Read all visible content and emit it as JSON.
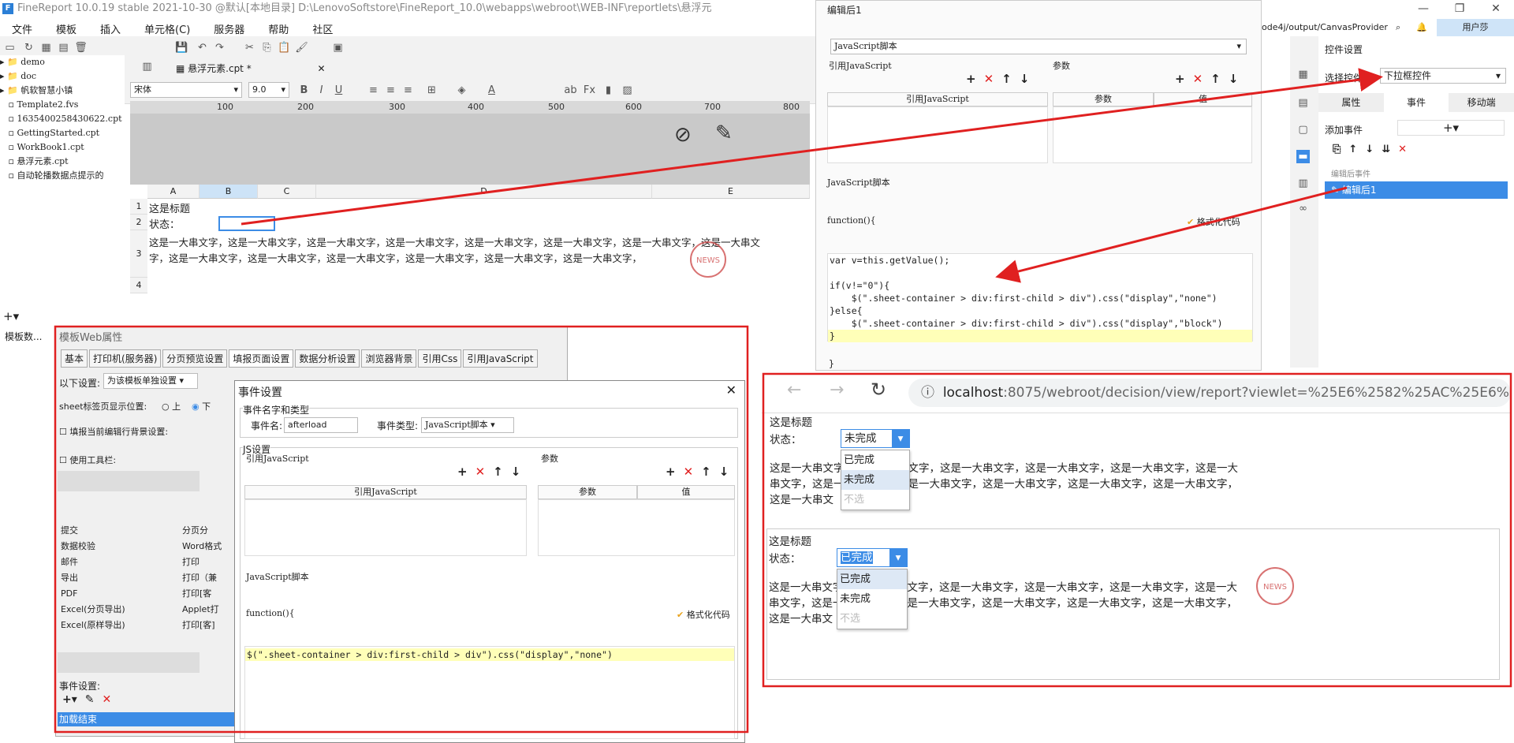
{
  "title": "FineReport 10.0.19 stable 2021-10-30 @默认[本地目录]   D:\\LenovoSoftstore\\FineReport_10.0\\webapps\\webroot\\WEB-INF\\reportlets\\悬浮元",
  "window_controls": [
    "—",
    "❐",
    "✕"
  ],
  "menu": [
    "文件",
    "模板",
    "插入",
    "单元格(C)",
    "服务器",
    "帮助",
    "社区"
  ],
  "file_tree": [
    "demo",
    "doc",
    "帆软智慧小镇",
    "Template2.fvs",
    "1635400258430622.cpt",
    "GettingStarted.cpt",
    "WorkBook1.cpt",
    "悬浮元素.cpt",
    "自动轮播数据点提示的"
  ],
  "left_bottom_label": "模板数...",
  "doc_tab": "悬浮元素.cpt *",
  "font_name": "宋体",
  "font_size": "9.0",
  "ruler": [
    "0",
    "100",
    "200",
    "300",
    "400",
    "500",
    "600",
    "700",
    "800"
  ],
  "ruler_right": "400",
  "columns": [
    "A",
    "B",
    "C",
    "D",
    "E"
  ],
  "rows": [
    "1",
    "2",
    "3",
    "4"
  ],
  "sheet": {
    "title_cell": "这是标题",
    "status_label": "状态：",
    "long_text": "这是一大串文字，这是一大串文字，这是一大串文字，这是一大串文字，这是一大串文字，这是一大串文字，这是一大串文字，这是一大串文字，这是一大串文字，这是一大串文字，这是一大串文字，这是一大串文字，这是一大串文字，这是一大串文字，"
  },
  "stamp_text": "NEWS",
  "js_dialog": {
    "title": "编辑后1",
    "type": "JavaScript脚本",
    "ref_js": "引用JavaScript",
    "params": "参数",
    "col_ref": "引用JavaScript",
    "col_param": "参数",
    "col_value": "值",
    "script_label": "JavaScript脚本",
    "fn_header": "function(){",
    "format_code": "格式化代码",
    "code": "var v=this.getValue();\n\nif(v!=\"0\"){\n    $(\".sheet-container > div:first-child > div\").css(\"display\",\"none\")\n}else{\n    $(\".sheet-container > div:first-child > div\").css(\"display\",\"block\")\n}",
    "closing": "}"
  },
  "props": {
    "path": "ode4j/output/CanvasProvider",
    "user": "用户莎",
    "header": "控件设置",
    "select_label": "选择控件",
    "select_value": "下拉框控件",
    "tabs": [
      "属性",
      "事件",
      "移动端"
    ],
    "add_event": "添加事件",
    "after_edit_event": "编辑后事件",
    "event_item": "编辑后1"
  },
  "web_dialog": {
    "title": "模板Web属性",
    "tabs": [
      "基本",
      "打印机(服务器)",
      "分页预览设置",
      "填报页面设置",
      "数据分析设置",
      "浏览器背景",
      "引用Css",
      "引用JavaScript"
    ],
    "setting_label": "以下设置:",
    "setting_value": "为该模板单独设置",
    "sheet_pos": "sheet标签页显示位置:",
    "pos_top": "上",
    "pos_bottom": "下",
    "fill_bg": "填报当前编辑行背景设置:",
    "use_toolbar": "使用工具栏:",
    "buttons_left": [
      "提交",
      "数据校验",
      "邮件",
      "导出",
      "PDF",
      "Excel(分页导出)",
      "Excel(原样导出)"
    ],
    "buttons_right": [
      "分页分",
      "Word格式",
      "打印",
      "打印（兼",
      "打印[客",
      "Applet打",
      "打印[客]"
    ],
    "event_settings": "事件设置:",
    "event_item": "加载结束"
  },
  "event_dialog": {
    "title": "事件设置",
    "group_name": "事件名字和类型",
    "name_label": "事件名:",
    "name_value": "afterload",
    "type_label": "事件类型:",
    "type_value": "JavaScript脚本",
    "js_settings": "JS设置",
    "ref_js": "引用JavaScript",
    "params": "参数",
    "col_ref": "引用JavaScript",
    "col_param": "参数",
    "col_value": "值",
    "script_label": "JavaScript脚本",
    "fn_header": "function(){",
    "format_code": "格式化代码",
    "code": "$(\".sheet-container > div:first-child > div\").css(\"display\",\"none\")"
  },
  "browser": {
    "url_host": "localhost",
    "url_rest": ":8075/webroot/decision/view/report?viewlet=%25E6%2582%25AC%25E6%25B5%",
    "title1": "这是标题",
    "status1": "状态：",
    "value1": "未完成",
    "options1": [
      "已完成",
      "未完成",
      "不选"
    ],
    "text1a": "这是一大串文字，这是一大串文字，这是一大串文字，这是一大串文字，这是一大串文字，这是一大",
    "text1b": "串文字，这是一大串文字，这是一大串文字，这是一大串文字，这是一大串文字，这是一大串文字，",
    "text1c": "这是一大串文",
    "title2": "这是标题",
    "status2": "状态：",
    "value2": "已完成",
    "options2": [
      "已完成",
      "未完成",
      "不选"
    ],
    "text2a": "这是一大串文字，这是一大串文字，这是一大串文字，这是一大串文字，这是一大串文字，这是一大",
    "text2b": "串文字，这是一大串文字，这是一大串文字，这是一大串文字，这是一大串文字，这是一大串文字，",
    "text2c": "这是一大串文"
  },
  "colors": {
    "accent": "#2b7fd6",
    "annotation": "#e02020",
    "selected": "#3c8ce6",
    "highlight": "#ffffb8"
  }
}
